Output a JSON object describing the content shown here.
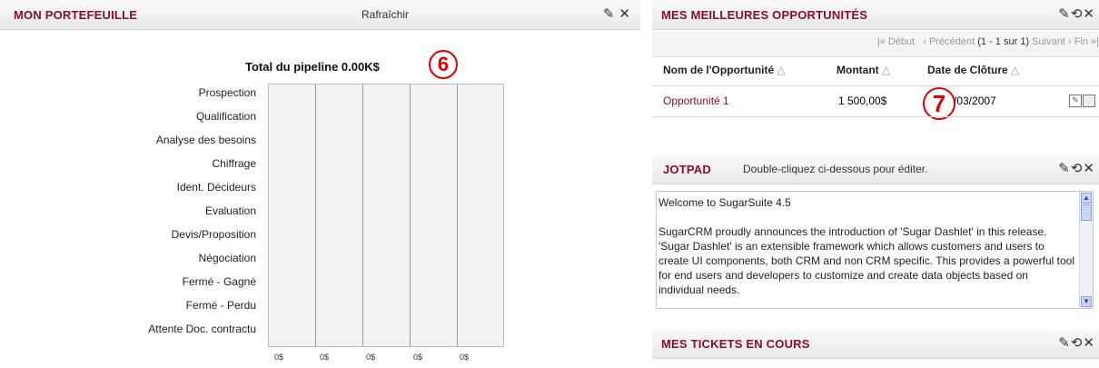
{
  "portfolio": {
    "title": "MON PORTEFEUILLE",
    "refresh": "Rafraîchir",
    "chart_title": "Total du pipeline 0.00K$",
    "annotation": "6",
    "tools": [
      "edit-icon",
      "close-icon"
    ]
  },
  "chart_data": {
    "type": "bar",
    "title": "Total du pipeline 0.00K$",
    "categories": [
      "Prospection",
      "Qualification",
      "Analyse des besoins",
      "Chiffrage",
      "Ident. Décideurs",
      "Evaluation",
      "Devis/Proposition",
      "Négociation",
      "Fermé - Gagné",
      "Fermé - Perdu",
      "Attente Doc. contractu"
    ],
    "values": [
      0,
      0,
      0,
      0,
      0,
      0,
      0,
      0,
      0,
      0,
      0
    ],
    "x_ticks": [
      "0$",
      "0$",
      "0$",
      "0$",
      "0$"
    ],
    "orientation": "horizontal",
    "grid": true
  },
  "opportunities": {
    "title": "MES MEILLEURES OPPORTUNITÉS",
    "pager": {
      "start": "Début",
      "prev": "Précédent",
      "count": "(1 - 1 sur 1)",
      "next": "Suivant",
      "end": "Fin"
    },
    "columns": [
      "Nom de l'Opportunité",
      "Montant",
      "Date de Clôture"
    ],
    "rows": [
      {
        "name": "Opportunité 1",
        "amount": "1 500,00$",
        "date": "/03/2007"
      }
    ],
    "annotation": "7"
  },
  "jotpad": {
    "title": "JOTPAD",
    "hint": "Double-cliquez ci-dessous pour éditer.",
    "line1": "Welcome to SugarSuite 4.5",
    "para": "SugarCRM proudly announces the introduction of 'Sugar Dashlet' in this release. 'Sugar Dashlet' is an extensible framework which allows customers and users to create UI components, both CRM and non CRM specific. This provides a powerful tool for end users and developers to customize and create data objects based on individual needs."
  },
  "tickets": {
    "title": "MES TICKETS EN COURS"
  }
}
